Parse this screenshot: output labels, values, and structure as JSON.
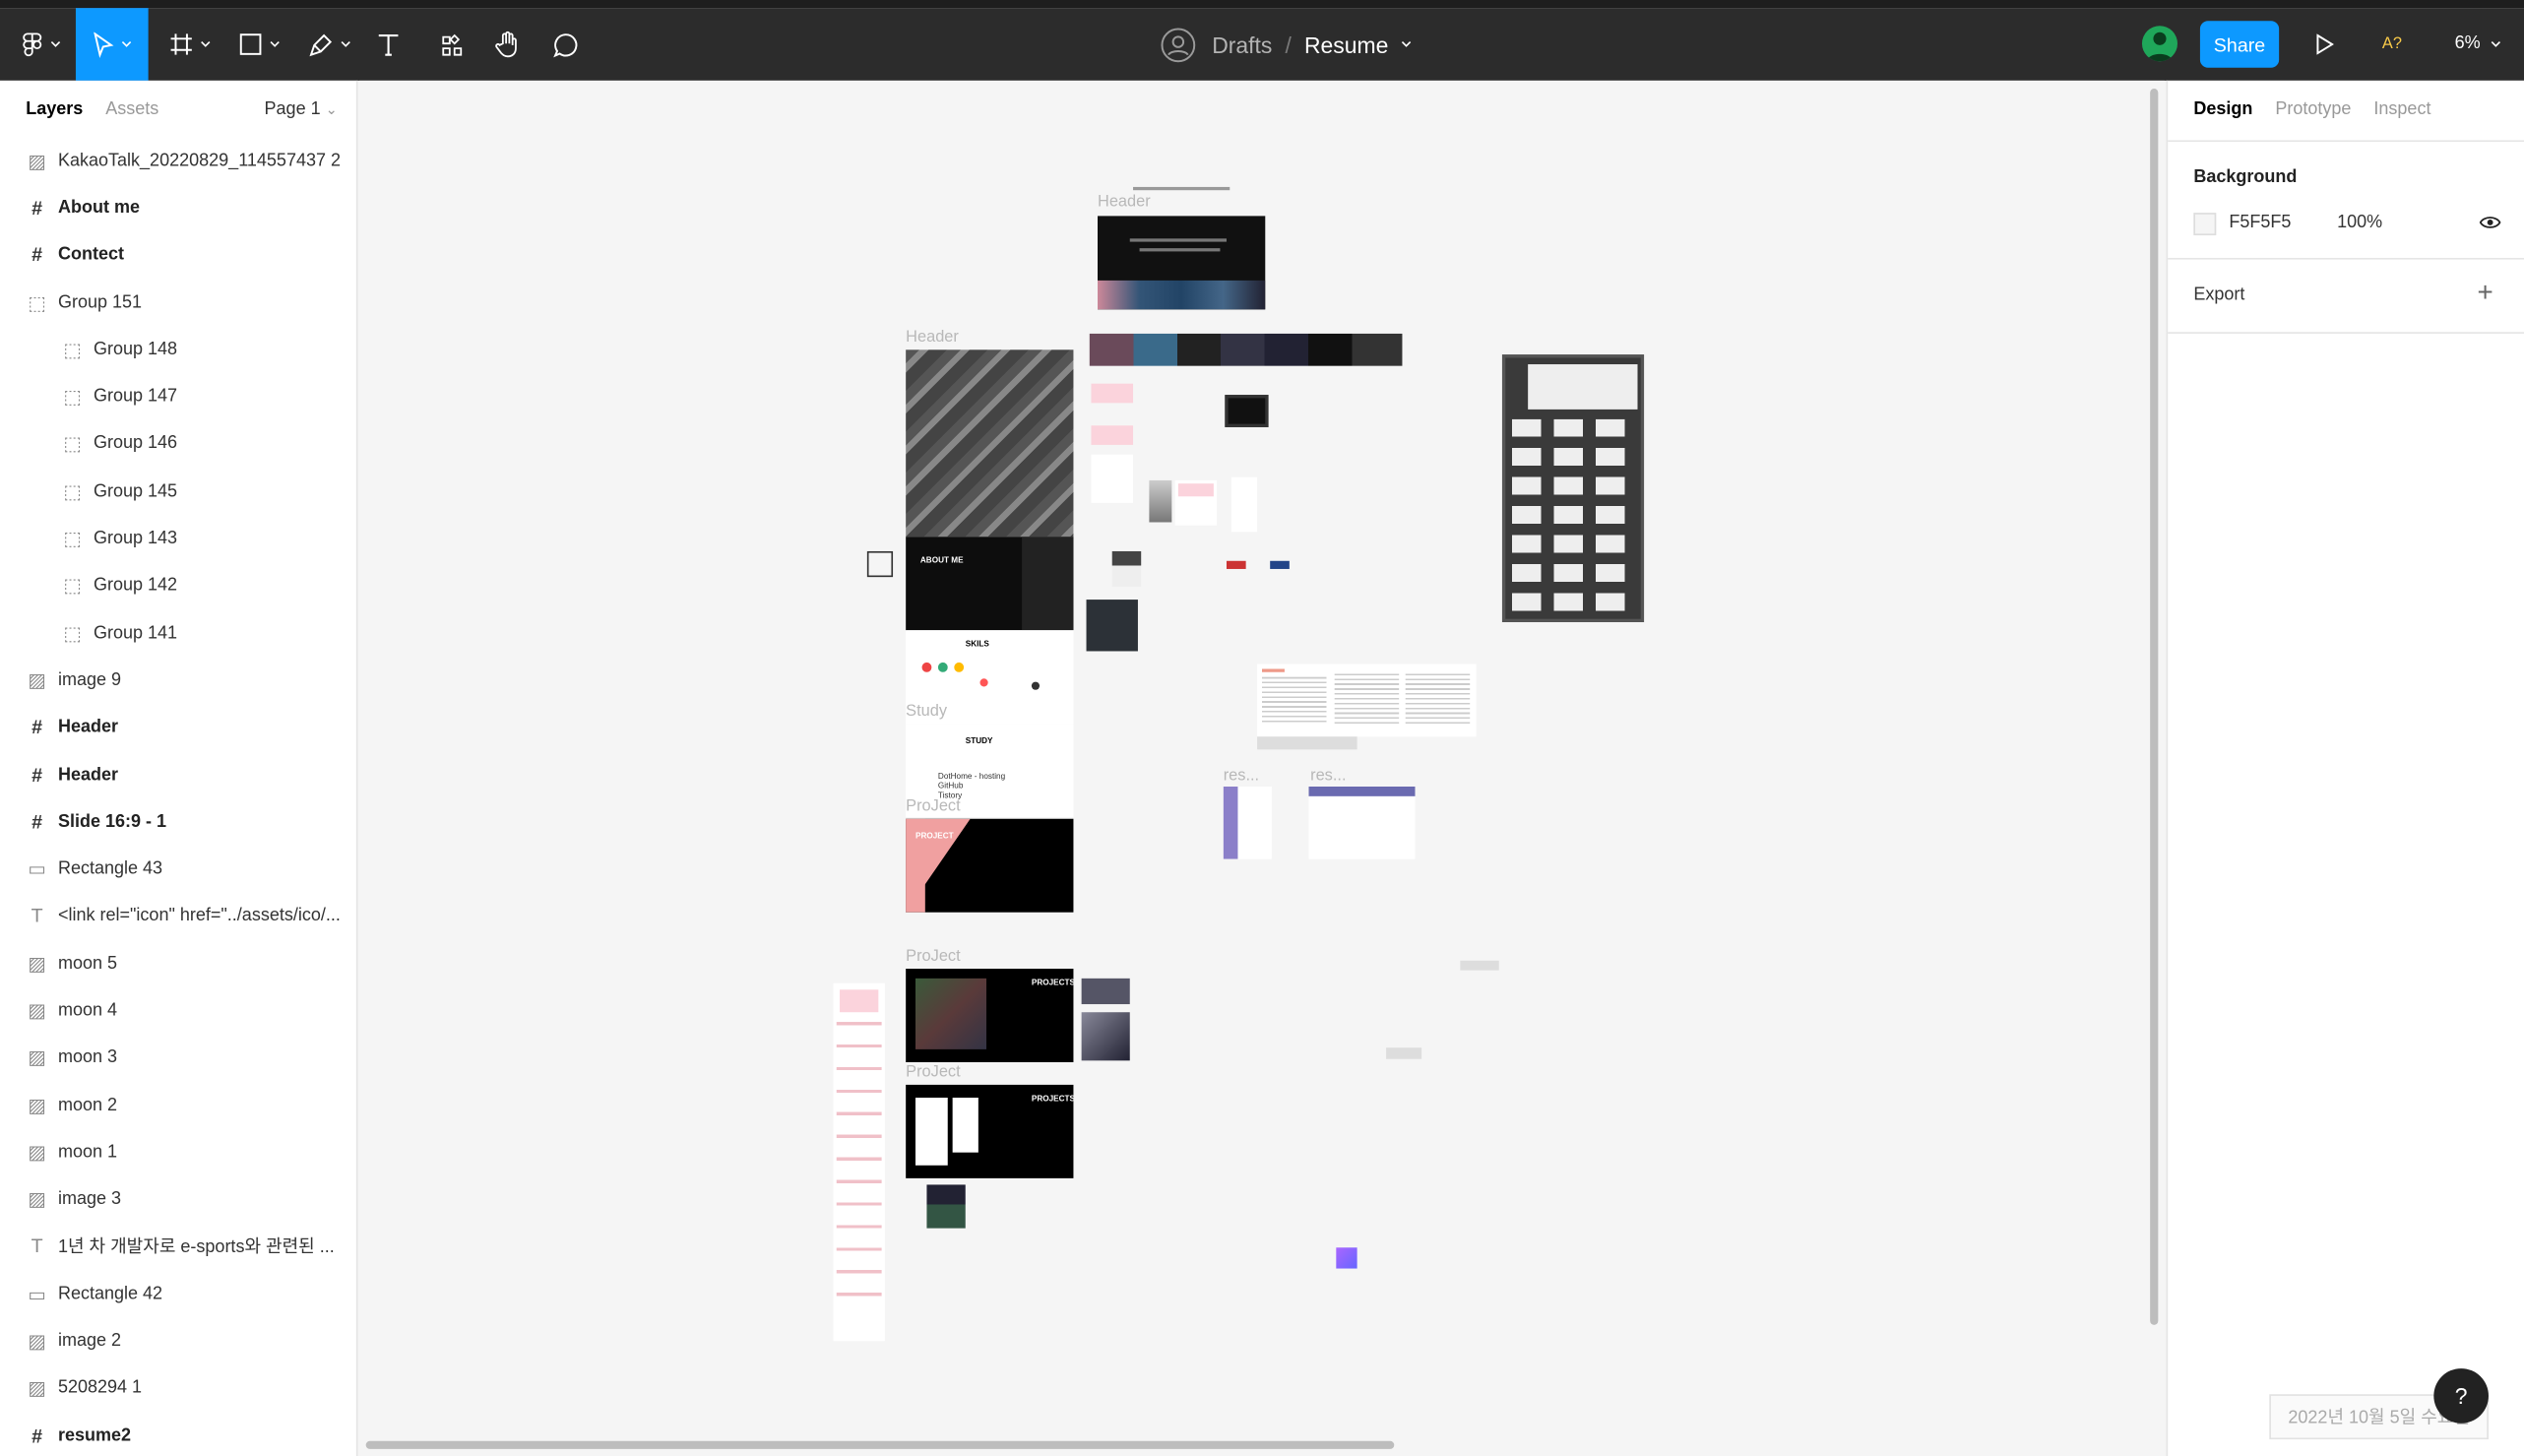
{
  "toolbar": {
    "breadcrumb_parent": "Drafts",
    "breadcrumb_sep": "/",
    "file_name": "Resume",
    "share_label": "Share",
    "font_warning": "A?",
    "zoom": "6%"
  },
  "left_panel": {
    "tab_layers": "Layers",
    "tab_assets": "Assets",
    "page": "Page 1",
    "layers": [
      {
        "name": "KakaoTalk_20220829_114557437 2",
        "kind": "image"
      },
      {
        "name": "About me",
        "kind": "frame"
      },
      {
        "name": "Contect",
        "kind": "frame"
      },
      {
        "name": "Group 151",
        "kind": "group"
      },
      {
        "name": "Group 148",
        "kind": "group-child"
      },
      {
        "name": "Group 147",
        "kind": "group-child"
      },
      {
        "name": "Group 146",
        "kind": "group-child"
      },
      {
        "name": "Group 145",
        "kind": "group-child"
      },
      {
        "name": "Group 143",
        "kind": "group-child"
      },
      {
        "name": "Group 142",
        "kind": "group-child"
      },
      {
        "name": "Group 141",
        "kind": "group-child"
      },
      {
        "name": "image 9",
        "kind": "image"
      },
      {
        "name": "Header",
        "kind": "frame"
      },
      {
        "name": "Header",
        "kind": "frame"
      },
      {
        "name": "Slide 16:9 - 1",
        "kind": "frame"
      },
      {
        "name": "Rectangle 43",
        "kind": "rect"
      },
      {
        "name": "<link rel=\"icon\" href=\"../assets/ico/...",
        "kind": "text"
      },
      {
        "name": "moon 5",
        "kind": "image"
      },
      {
        "name": "moon 4",
        "kind": "image"
      },
      {
        "name": "moon 3",
        "kind": "image"
      },
      {
        "name": "moon 2",
        "kind": "image"
      },
      {
        "name": "moon 1",
        "kind": "image"
      },
      {
        "name": "image 3",
        "kind": "image"
      },
      {
        "name": "1년 차 개발자로 e-sports와 관련된 ...",
        "kind": "text"
      },
      {
        "name": "Rectangle 42",
        "kind": "rect"
      },
      {
        "name": "image 2",
        "kind": "image"
      },
      {
        "name": "5208294 1",
        "kind": "image"
      },
      {
        "name": "resume2",
        "kind": "frame"
      }
    ]
  },
  "right_panel": {
    "tab_design": "Design",
    "tab_prototype": "Prototype",
    "tab_inspect": "Inspect",
    "background_label": "Background",
    "background_hex": "F5F5F5",
    "background_opacity": "100%",
    "export_label": "Export",
    "colors": {
      "accent": "#0d99ff",
      "canvas": "#f5f5f5"
    }
  },
  "canvas": {
    "frame_labels": {
      "header_top": "Header",
      "header": "Header",
      "study": "Study",
      "project_1": "ProJect",
      "project_2": "ProJect",
      "project_3": "ProJect",
      "res_1": "res...",
      "res_2": "res..."
    },
    "slide_text": {
      "skils": "SKILS",
      "study": "STUDY",
      "study_items": [
        "DotHome - hosting",
        "GitHub",
        "Tistory"
      ],
      "about": "ABOUT ME",
      "project": "PROJECT",
      "projects": "PROJECTS"
    }
  },
  "footer": {
    "date_badge": "2022년 10월 5일 수요일",
    "help": "?"
  }
}
